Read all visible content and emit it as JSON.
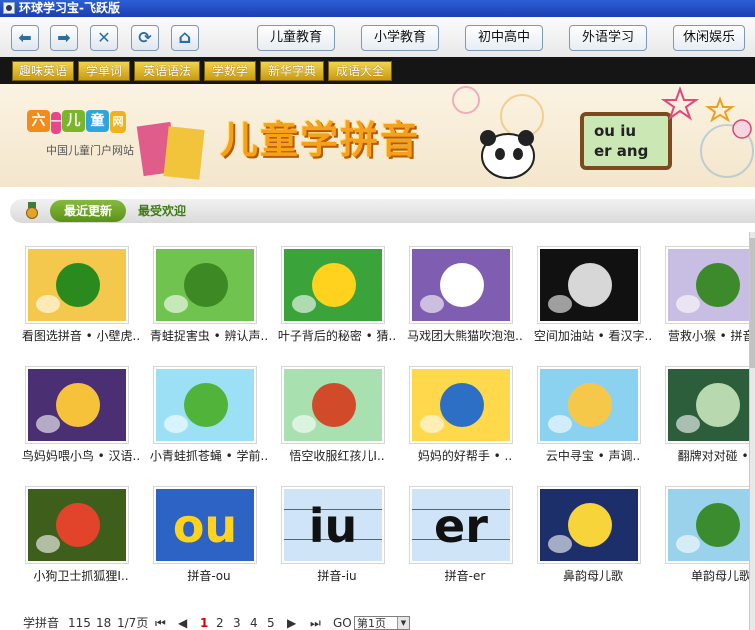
{
  "window": {
    "title": "环球学习宝-飞跃版"
  },
  "toolbar": {
    "nav": [
      {
        "name": "back-button",
        "glyph": "⬅"
      },
      {
        "name": "forward-button",
        "glyph": "➡"
      },
      {
        "name": "stop-button",
        "glyph": "✕"
      },
      {
        "name": "refresh-button",
        "glyph": "⟳"
      },
      {
        "name": "home-button",
        "glyph": "⌂"
      }
    ],
    "categories": [
      "儿童教育",
      "小学教育",
      "初中高中",
      "外语学习",
      "休闲娱乐"
    ]
  },
  "tabs": [
    "趣味英语",
    "学单词",
    "英语语法",
    "学数学",
    "新华字典",
    "成语大全"
  ],
  "banner": {
    "logo_chars": [
      "六",
      "一",
      "儿",
      "童",
      "网"
    ],
    "logo_sub": "中国儿童门户网站",
    "title": "儿童学拼音",
    "board_lines": [
      "ou  iu",
      "er ang"
    ]
  },
  "section": {
    "active_tab": "最近更新",
    "other_tab": "最受欢迎"
  },
  "items": [
    {
      "caption": "看图选拼音 • 小壁虎..",
      "bg": "#f4c84c",
      "accent": "#2a8a1e"
    },
    {
      "caption": "青蛙捉害虫 • 辨认声..",
      "bg": "#71c34f",
      "accent": "#3d8a24"
    },
    {
      "caption": "叶子背后的秘密 • 猜..",
      "bg": "#3aa43a",
      "accent": "#ffd21e"
    },
    {
      "caption": "马戏团大熊猫吹泡泡..",
      "bg": "#7f5db0",
      "accent": "#ffffff"
    },
    {
      "caption": "空间加油站 • 看汉字..",
      "bg": "#111111",
      "accent": "#d7d7d7"
    },
    {
      "caption": "营救小猴 • 拼音习..",
      "bg": "#c8bde2",
      "accent": "#3c8a2b"
    },
    {
      "caption": "鸟妈妈喂小鸟 • 汉语..",
      "bg": "#4a2f73",
      "accent": "#f6c23a"
    },
    {
      "caption": "小青蛙抓苍蝇 • 学前..",
      "bg": "#9ce0f5",
      "accent": "#52b33a"
    },
    {
      "caption": "悟空收服红孩儿I..",
      "bg": "#a8e0b0",
      "accent": "#d14b2b"
    },
    {
      "caption": "妈妈的好帮手 • ..",
      "bg": "#ffd84c",
      "accent": "#2d6fc4"
    },
    {
      "caption": "云中寻宝 • 声调..",
      "bg": "#8bd2f1",
      "accent": "#f6c84a"
    },
    {
      "caption": "翻牌对对碰 • 汉",
      "bg": "#2c5e3c",
      "accent": "#b8d8b0"
    },
    {
      "caption": "小狗卫士抓狐狸I..",
      "bg": "#3e5e1c",
      "accent": "#e2442b"
    },
    {
      "caption": "拼音-ou",
      "bg": "#2d63c4",
      "accent": "#ffd21e",
      "text": "ou"
    },
    {
      "caption": "拼音-iu",
      "bg": "#cfe5f7",
      "accent": "#111111",
      "text": "iu"
    },
    {
      "caption": "拼音-er",
      "bg": "#cfe5f7",
      "accent": "#111111",
      "text": "er"
    },
    {
      "caption": "鼻韵母儿歌",
      "bg": "#1c2f6b",
      "accent": "#f6d43a"
    },
    {
      "caption": "单韵母儿歌",
      "bg": "#9ad2ec",
      "accent": "#3a8c2e"
    }
  ],
  "pager": {
    "label": "学拼音",
    "total": "115",
    "per_page": "18",
    "page_info": "1/7页",
    "first": "⏮",
    "prev": "◀",
    "pages": [
      "1",
      "2",
      "3",
      "4",
      "5"
    ],
    "next": "▶",
    "last": "⏭",
    "go": "GO",
    "select_value": "第1页"
  }
}
